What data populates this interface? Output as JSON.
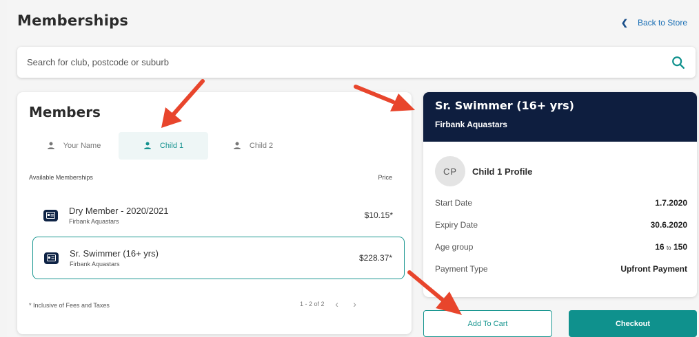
{
  "header": {
    "title": "Memberships",
    "back_label": "Back to Store"
  },
  "search": {
    "placeholder": "Search for club, postcode or suburb"
  },
  "members": {
    "title": "Members",
    "tabs": [
      {
        "label": "Your Name",
        "active": false
      },
      {
        "label": "Child 1",
        "active": true
      },
      {
        "label": "Child 2",
        "active": false
      }
    ],
    "list_header_left": "Available Memberships",
    "list_header_right": "Price",
    "memberships": [
      {
        "name": "Dry Member - 2020/2021",
        "club": "Firbank Aquastars",
        "price": "$10.15*",
        "selected": false
      },
      {
        "name": "Sr. Swimmer (16+ yrs)",
        "club": "Firbank Aquastars",
        "price": "$228.37*",
        "selected": true
      }
    ],
    "footnote": "* Inclusive of Fees and Taxes",
    "pagination": "1 - 2 of 2"
  },
  "detail": {
    "title": "Sr. Swimmer (16+ yrs)",
    "club": "Firbank Aquastars",
    "avatar_initials": "CP",
    "profile_name": "Child 1 Profile",
    "start_label": "Start Date",
    "start_value": "1.7.2020",
    "expiry_label": "Expiry Date",
    "expiry_value": "30.6.2020",
    "age_label": "Age group",
    "age_from": "16",
    "age_to_word": "to",
    "age_to": "150",
    "payment_label": "Payment Type",
    "payment_value": "Upfront Payment"
  },
  "actions": {
    "add_to_cart": "Add To Cart",
    "checkout": "Checkout"
  },
  "colors": {
    "accent": "#0f918d",
    "navy": "#0e1e3f",
    "arrow": "#e8452c"
  }
}
